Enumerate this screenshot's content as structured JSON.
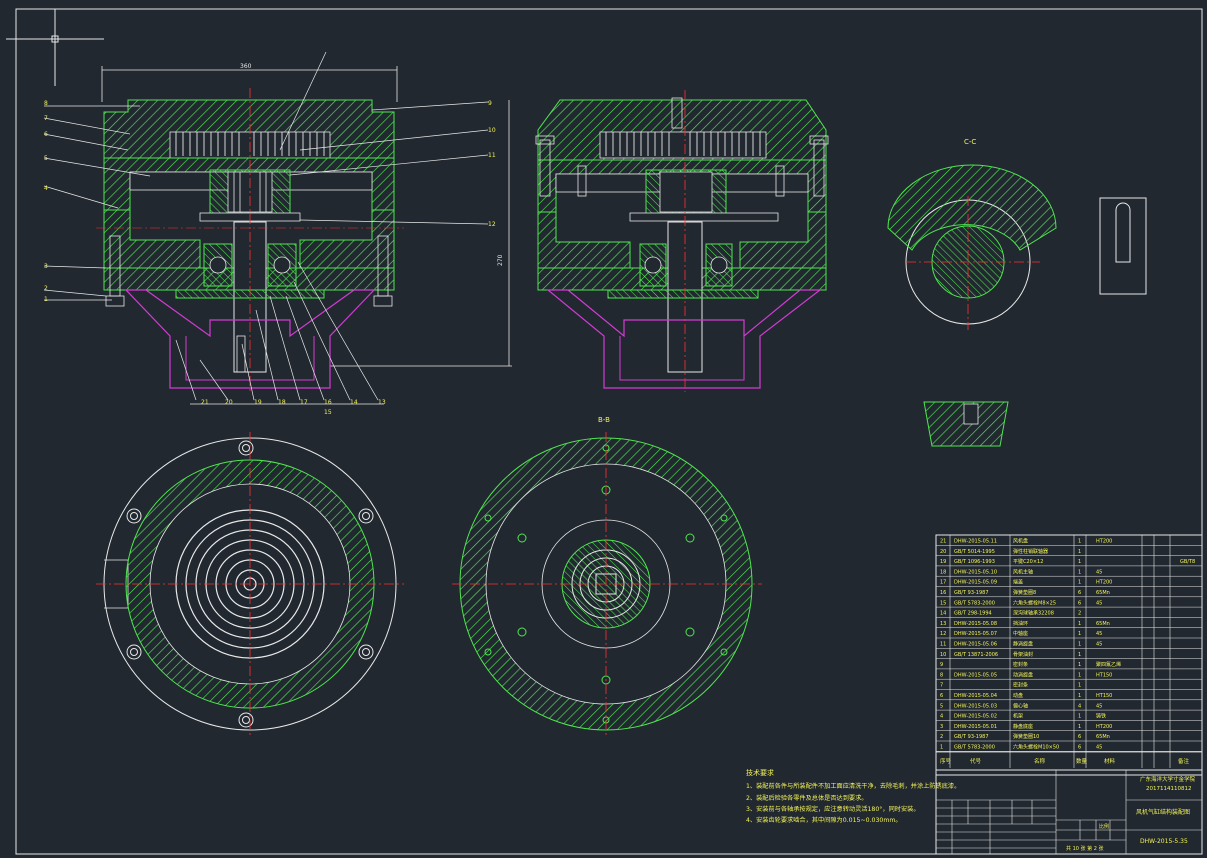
{
  "title_block": {
    "company_line1": "广东海洋大学寸金学院",
    "company_line2": "2017114110812",
    "drawing_title": "风机气缸结构装配图",
    "drawing_number": "DHW-2015-5.35",
    "scale_label": "比例",
    "sheet_text": "共 10 张  第 2 张",
    "header_labels": [
      "序号",
      "代号",
      "名称",
      "数量",
      "材料",
      "备注"
    ]
  },
  "tech_requirements": {
    "heading": "技术要求",
    "lines": [
      "1、装配前各件与所装配件不加工面应清洗干净，去除毛刺，并涂上防锈底漆。",
      "2、装配后检验各零件及总体是否达到要求。",
      "3、安装前与各轴承按规定，应注意转动灵活180°，同时安装。",
      "4、安装齿轮要求啮合，其中间隙为0.015~0.030mm。"
    ]
  },
  "views": {
    "section_c_label": "C-C",
    "section_b_label": "B-B",
    "dim_width": "360",
    "dim_height": "270"
  },
  "bom": [
    {
      "no": "21",
      "code": "DHW-2015-05.11",
      "name": "风机盘",
      "qty": "1",
      "material": "HT200",
      "note": ""
    },
    {
      "no": "20",
      "code": "GB/T 5014-1995",
      "name": "弹性柱销联轴器",
      "qty": "1",
      "material": "",
      "note": ""
    },
    {
      "no": "19",
      "code": "GB/T 1096-1993",
      "name": "平键C20×12",
      "qty": "1",
      "material": "",
      "note": "GB/T8"
    },
    {
      "no": "18",
      "code": "DHW-2015-05.10",
      "name": "风机主轴",
      "qty": "1",
      "material": "45",
      "note": ""
    },
    {
      "no": "17",
      "code": "DHW-2015-05.09",
      "name": "端盖",
      "qty": "1",
      "material": "HT200",
      "note": ""
    },
    {
      "no": "16",
      "code": "GB/T 93-1987",
      "name": "弹簧垫圈8",
      "qty": "6",
      "material": "65Mn",
      "note": ""
    },
    {
      "no": "15",
      "code": "GB/T 5783-2000",
      "name": "六角头螺栓M8×25",
      "qty": "6",
      "material": "45",
      "note": ""
    },
    {
      "no": "14",
      "code": "GB/T 298-1994",
      "name": "深沟球轴承32208",
      "qty": "2",
      "material": "",
      "note": ""
    },
    {
      "no": "13",
      "code": "DHW-2015-05.08",
      "name": "挡油环",
      "qty": "1",
      "material": "65Mn",
      "note": ""
    },
    {
      "no": "12",
      "code": "DHW-2015-05.07",
      "name": "中轴座",
      "qty": "1",
      "material": "45",
      "note": ""
    },
    {
      "no": "11",
      "code": "DHW-2015-05.06",
      "name": "静涡旋盘",
      "qty": "1",
      "material": "45",
      "note": ""
    },
    {
      "no": "10",
      "code": "GB/T 13871-2006",
      "name": "骨架油封",
      "qty": "1",
      "material": "",
      "note": ""
    },
    {
      "no": "9",
      "code": "",
      "name": "密封条",
      "qty": "1",
      "material": "聚四氟乙烯",
      "note": ""
    },
    {
      "no": "8",
      "code": "DHW-2015-05.05",
      "name": "动涡旋盘",
      "qty": "1",
      "material": "HT150",
      "note": ""
    },
    {
      "no": "7",
      "code": "",
      "name": "密封条",
      "qty": "1",
      "material": "",
      "note": ""
    },
    {
      "no": "6",
      "code": "DHW-2015-05.04",
      "name": "动盘",
      "qty": "1",
      "material": "HT150",
      "note": ""
    },
    {
      "no": "5",
      "code": "DHW-2015-05.03",
      "name": "偏心轴",
      "qty": "4",
      "material": "45",
      "note": ""
    },
    {
      "no": "4",
      "code": "DHW-2015-05.02",
      "name": "机架",
      "qty": "1",
      "material": "铸铁",
      "note": ""
    },
    {
      "no": "3",
      "code": "DHW-2015-05.01",
      "name": "静盘底座",
      "qty": "1",
      "material": "HT200",
      "note": ""
    },
    {
      "no": "2",
      "code": "GB/T 93-1987",
      "name": "弹簧垫圈10",
      "qty": "6",
      "material": "65Mn",
      "note": ""
    },
    {
      "no": "1",
      "code": "GB/T 5783-2000",
      "name": "六角头螺栓M10×50",
      "qty": "6",
      "material": "45",
      "note": ""
    }
  ],
  "leader_numbers_left": [
    "8",
    "7",
    "6",
    "5",
    "4",
    "3",
    "2",
    "1"
  ],
  "leader_numbers_right": [
    "9",
    "10",
    "11",
    "12"
  ],
  "leader_numbers_bottom": [
    "21",
    "20",
    "19",
    "18",
    "17",
    "16",
    "15",
    "14",
    "13"
  ],
  "colors": {
    "background": "#212830",
    "green": "#4fe64f",
    "white": "#e8e8e8",
    "red": "#ff3030",
    "magenta": "#d23cd2",
    "yellow": "#f3f35a"
  }
}
